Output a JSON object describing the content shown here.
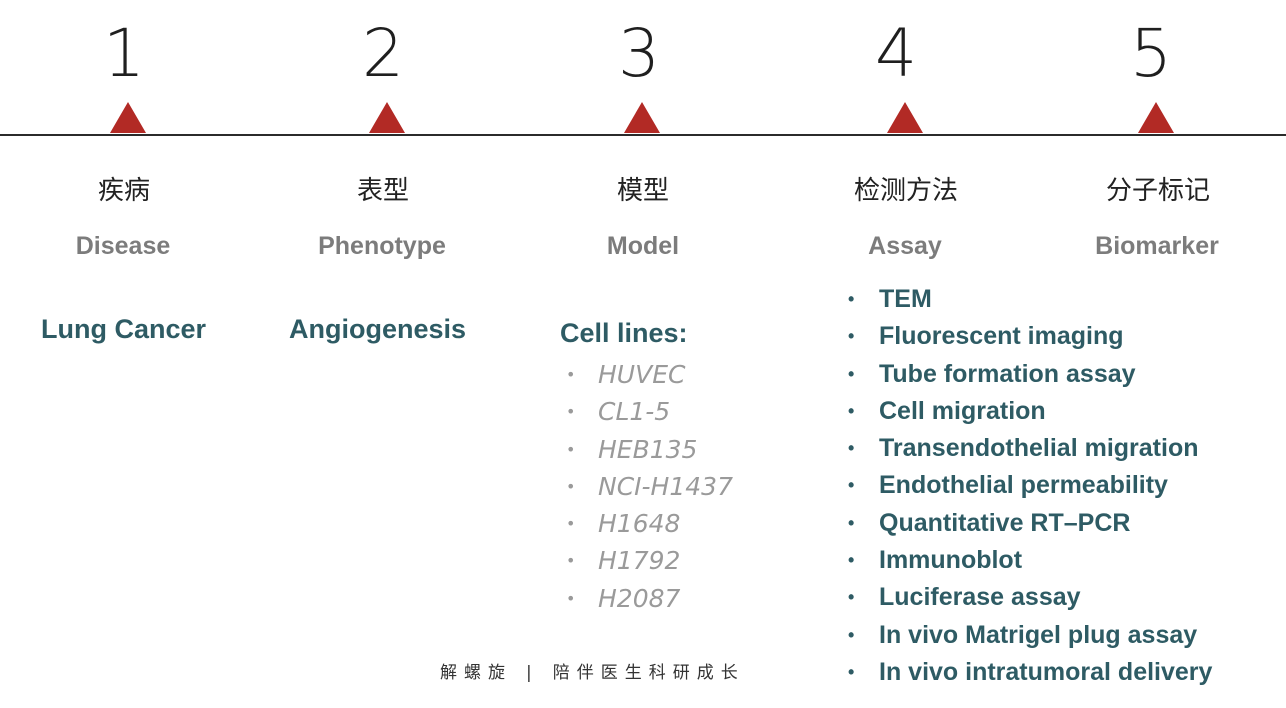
{
  "steps": [
    {
      "number": "1",
      "zh": "疾病",
      "en": "Disease"
    },
    {
      "number": "2",
      "zh": "表型",
      "en": "Phenotype"
    },
    {
      "number": "3",
      "zh": "模型",
      "en": "Model"
    },
    {
      "number": "4",
      "zh": "检测方法",
      "en": "Assay"
    },
    {
      "number": "5",
      "zh": "分子标记",
      "en": "Biomarker"
    }
  ],
  "disease": "Lung Cancer",
  "phenotype": "Angiogenesis",
  "model": {
    "heading": "Cell lines:",
    "items": [
      "HUVEC",
      "CL1-5",
      "HEB135",
      "NCI-H1437",
      "H1648",
      "H1792",
      "H2087"
    ]
  },
  "assays": [
    "TEM",
    "Fluorescent imaging",
    "Tube formation assay",
    "Cell migration",
    "Transendothelial migration",
    "Endothelial permeability",
    "Quantitative RT–PCR",
    "Immunoblot",
    "Luciferase assay",
    "In vivo Matrigel plug assay",
    "In vivo intratumoral delivery"
  ],
  "footer": {
    "left": "解螺旋",
    "separator": "|",
    "right": "陪伴医生科研成长"
  },
  "colors": {
    "accent_triangle": "#b22a25",
    "content_teal": "#2e5b64",
    "label_gray": "#7c7c7c"
  }
}
